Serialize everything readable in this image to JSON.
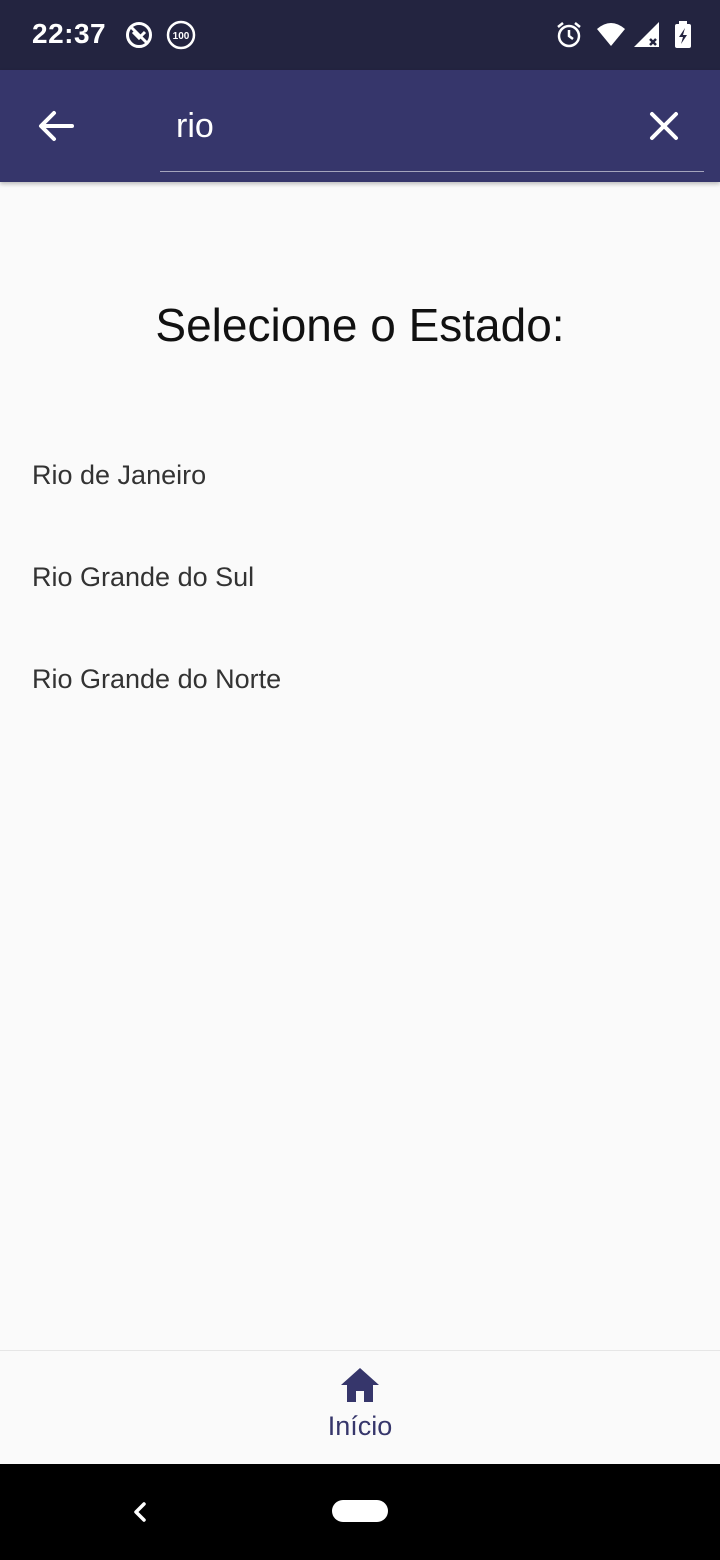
{
  "status_bar": {
    "time": "22:37",
    "icons": [
      "no-disturb-icon",
      "battery-saver-100-icon",
      "alarm-icon",
      "wifi-icon",
      "signal-icon",
      "battery-charging-icon"
    ],
    "badge_text": "100"
  },
  "app_bar": {
    "search_value": "rio",
    "back_icon": "arrow-back-icon",
    "clear_icon": "close-icon"
  },
  "main": {
    "title": "Selecione o Estado:",
    "states": [
      "Rio de Janeiro",
      "Rio Grande do Sul",
      "Rio Grande do Norte"
    ]
  },
  "bottom_nav": {
    "home_label": "Início",
    "home_icon": "home-icon"
  },
  "colors": {
    "status_bar": "#232440",
    "app_bar": "#36366b",
    "accent_cursor": "#f1c40f",
    "background": "#fafafa"
  }
}
